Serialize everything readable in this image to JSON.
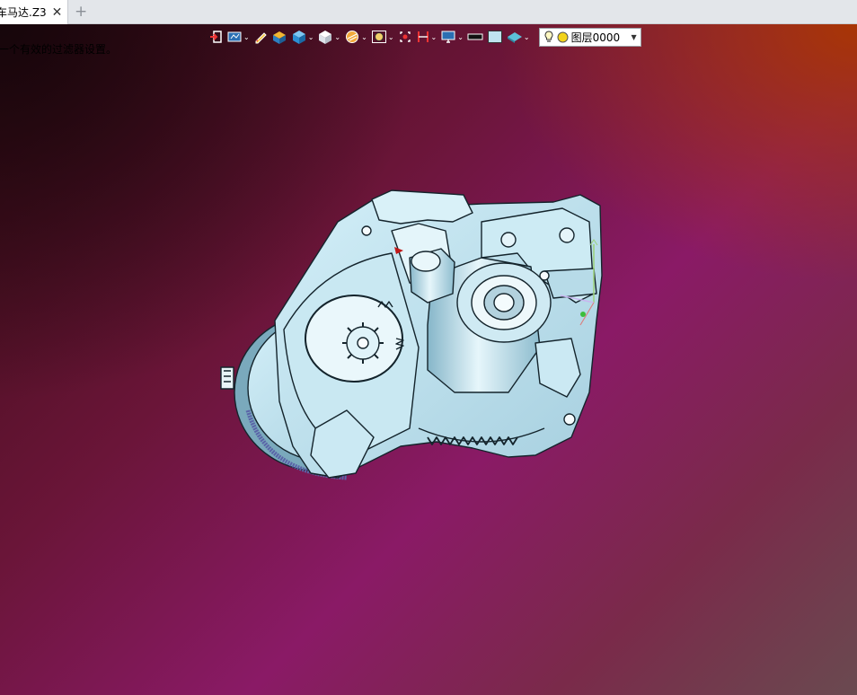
{
  "tab": {
    "title": "车马达.Z3"
  },
  "message": "一个有效的过滤器设置。",
  "toolbar": {
    "buttons": [
      "exit-icon",
      "sketch-view-icon",
      "pencil-icon",
      "solid-shade-icon",
      "cube-blue-icon",
      "cube-white-icon",
      "section-icon",
      "zoom-fit-icon",
      "snap-icon",
      "measure-icon",
      "display-icon",
      "color-black-icon",
      "color-light-icon",
      "shape-icon",
      "lightbulb-icon"
    ],
    "layer": "图层0000"
  },
  "colors": {
    "model_fill": "#bfe3ef",
    "model_shadow": "#6e9fb4",
    "model_edge": "#14242c"
  }
}
